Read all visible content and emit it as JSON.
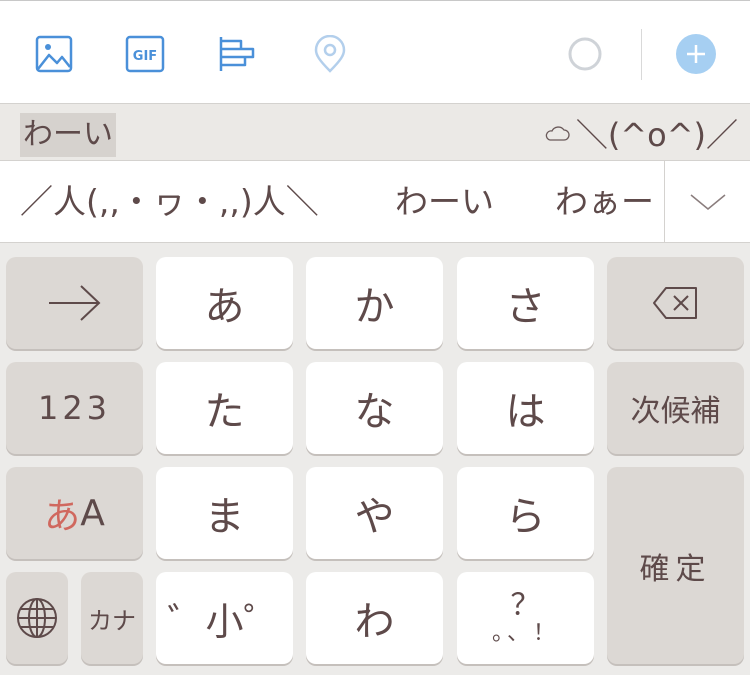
{
  "toolbar": {
    "icons": [
      {
        "name": "image-icon",
        "label": "Image"
      },
      {
        "name": "gif-icon",
        "label": "GIF"
      },
      {
        "name": "poll-icon",
        "label": "Poll"
      },
      {
        "name": "location-icon",
        "label": "Location"
      }
    ],
    "gif_text": "GIF",
    "char_counter": "progress-circle",
    "add_button": "add-icon",
    "accent_color": "#4a90d9"
  },
  "composing": {
    "text": "わーい",
    "kaomoji_suggestion": "＼(^o^)／"
  },
  "candidates": {
    "items": [
      "／人(,,・ヮ・,,)人＼",
      "わーい",
      "わぁー"
    ]
  },
  "keyboard": {
    "rows": [
      {
        "left": "→",
        "keys": [
          "あ",
          "か",
          "さ"
        ],
        "right": "delete"
      },
      {
        "left": "123",
        "keys": [
          "た",
          "な",
          "は"
        ],
        "right": "次候補"
      },
      {
        "left_kana": "あ",
        "left_latin": "A",
        "keys": [
          "ま",
          "や",
          "ら"
        ],
        "right": "確定"
      },
      {
        "globe": "globe",
        "kana": "カナ",
        "keys": [
          "゛゜小",
          "わ"
        ],
        "punct_top": "？",
        "punct_bottom": "。、！"
      }
    ],
    "dakuten_label": "゛小゜",
    "colors": {
      "key_text": "#5e4a4a",
      "kana_accent": "#d0685e"
    }
  }
}
